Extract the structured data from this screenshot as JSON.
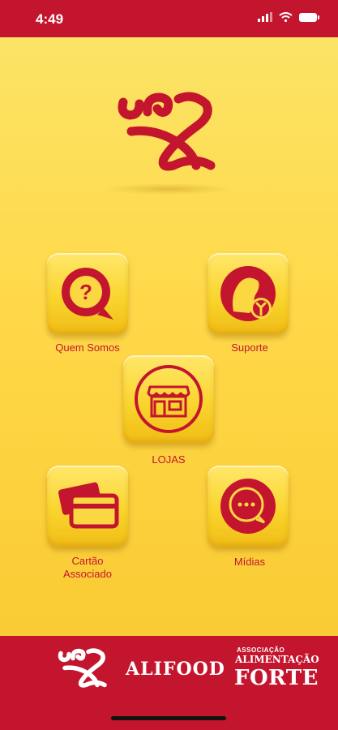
{
  "status": {
    "time": "4:49"
  },
  "menu": {
    "quem_somos": "Quem Somos",
    "suporte": "Suporte",
    "lojas": "LOJAS",
    "cartao_line1": "Cartão",
    "cartao_line2": "Associado",
    "midias": "Mídias"
  },
  "footer": {
    "brand": "ALIFOOD",
    "assoc_line1": "ASSOCIAÇÃO",
    "assoc_line2": "ALIMENTAÇÃO",
    "assoc_line3": "FORTE"
  },
  "colors": {
    "primary": "#c4152f",
    "accent": "#fbd742"
  }
}
